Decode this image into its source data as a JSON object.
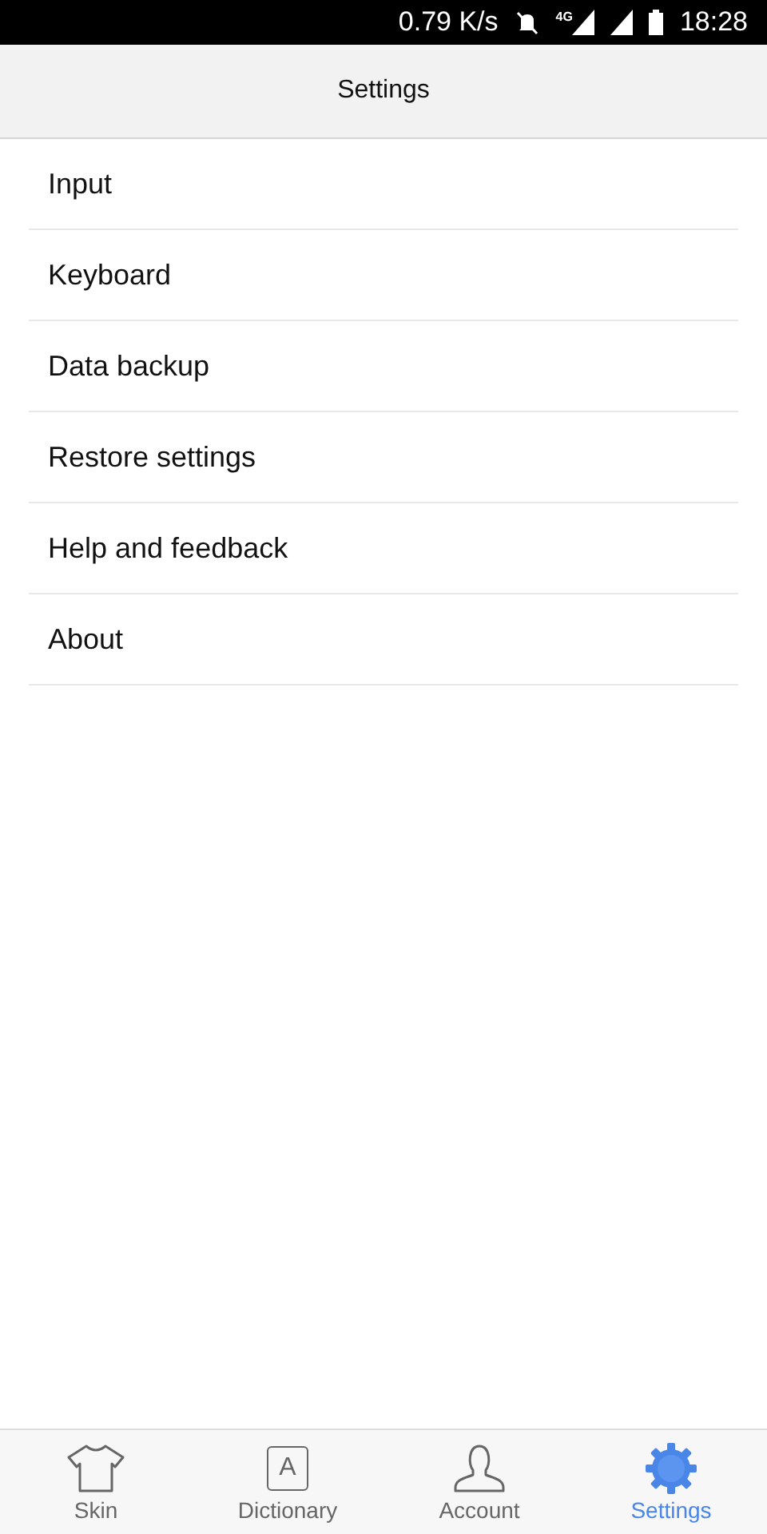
{
  "status_bar": {
    "speed": "0.79 K/s",
    "network": "4G",
    "time": "18:28"
  },
  "header": {
    "title": "Settings"
  },
  "menu": [
    {
      "label": "Input"
    },
    {
      "label": "Keyboard"
    },
    {
      "label": "Data backup"
    },
    {
      "label": "Restore settings"
    },
    {
      "label": "Help and feedback"
    },
    {
      "label": "About"
    }
  ],
  "tabs": [
    {
      "kind": "shirt",
      "label": "Skin",
      "selected": false
    },
    {
      "kind": "letter",
      "glyph": "A",
      "label": "Dictionary",
      "selected": false
    },
    {
      "kind": "person",
      "label": "Account",
      "selected": false
    },
    {
      "kind": "gear",
      "label": "Settings",
      "selected": true
    }
  ]
}
